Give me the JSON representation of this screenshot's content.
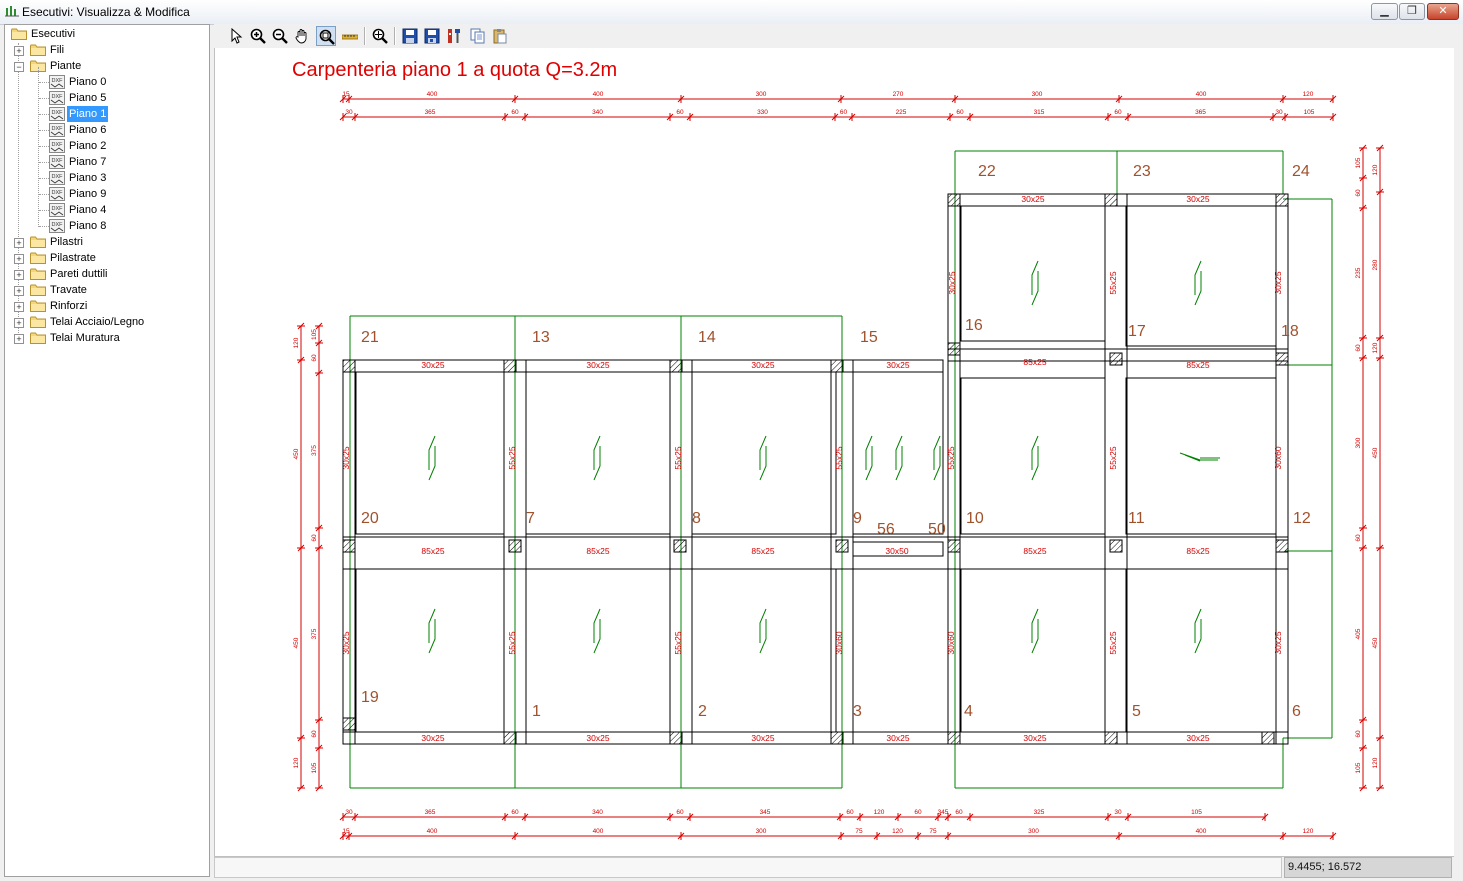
{
  "window": {
    "title": "Esecutivi: Visualizza & Modifica"
  },
  "tree": {
    "root": "Esecutivi",
    "fili": "Fili",
    "piante": "Piante",
    "piante_children": [
      "Piano 0",
      "Piano 5",
      "Piano 1",
      "Piano 6",
      "Piano 2",
      "Piano 7",
      "Piano 3",
      "Piano 9",
      "Piano 4",
      "Piano 8"
    ],
    "selected": "Piano 1",
    "after": [
      "Pilastri",
      "Pilastrate",
      "Pareti duttili",
      "Travate",
      "Rinforzi",
      "Telai Acciaio/Legno",
      "Telai Muratura"
    ]
  },
  "toolbar_icons": [
    "pointer-icon",
    "zoom-in-icon",
    "zoom-out-icon",
    "pan-hand-icon",
    "zoom-window-icon",
    "measure-ruler-icon",
    "zoom-extents-icon",
    "save-icon",
    "save-as-icon",
    "tools-icon",
    "copy-icon",
    "paste-icon"
  ],
  "drawing": {
    "title": "Carpenteria piano 1 a quota Q=3.2m",
    "title_color": "#e00000",
    "dim_color": "#d40000",
    "frame_color": "#008000",
    "label_color": "#a0522d",
    "top_dims_1": [
      "15",
      "400",
      "400",
      "300",
      "270",
      "300",
      "400",
      "120"
    ],
    "top_dims_2": [
      "30",
      "365",
      "60",
      "340",
      "60",
      "330",
      "60",
      "225",
      "60",
      "315",
      "60",
      "365",
      "30",
      "105"
    ],
    "bottom_dims_1": [
      "30",
      "365",
      "60",
      "340",
      "60",
      "345",
      "60",
      "120",
      "60",
      "345",
      "60",
      "325",
      "30",
      "105"
    ],
    "bottom_dims_2": [
      "15",
      "400",
      "400",
      "300",
      "75",
      "120",
      "75",
      "300",
      "400",
      "120"
    ],
    "left_dims_outer": [
      "120",
      "450",
      "450",
      "120"
    ],
    "left_dims_inner": [
      "105",
      "60",
      "375",
      "60",
      "375",
      "60",
      "105"
    ],
    "right_dims_outer": [
      "120",
      "280",
      "120",
      "450",
      "450",
      "120"
    ],
    "right_dims_inner": [
      "105",
      "60",
      "235",
      "60",
      "300",
      "60",
      "405",
      "60",
      "105"
    ],
    "column_labels": [
      "1",
      "2",
      "3",
      "4",
      "5",
      "6",
      "7",
      "8",
      "9",
      "10",
      "11",
      "12",
      "13",
      "14",
      "15",
      "16",
      "17",
      "18",
      "19",
      "20",
      "21",
      "22",
      "23",
      "24",
      "56",
      "50"
    ],
    "beam_sizes": [
      "30x25",
      "85x25",
      "55x25",
      "30x60",
      "30x50",
      "60"
    ]
  },
  "status": {
    "coords": "9.4455; 16.572"
  }
}
